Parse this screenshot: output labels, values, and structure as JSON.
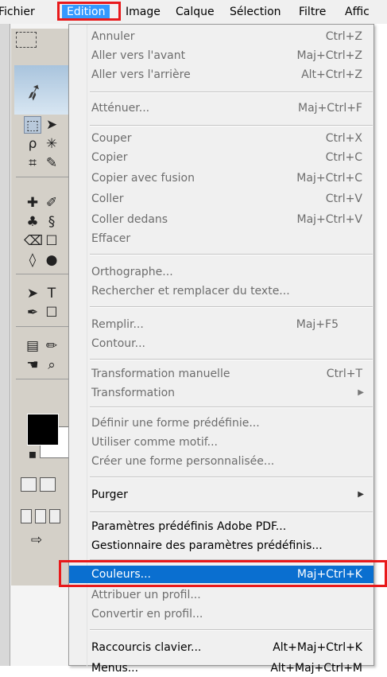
{
  "menubar": {
    "items": [
      {
        "label": "Fichier"
      },
      {
        "label": "Edition"
      },
      {
        "label": "Image"
      },
      {
        "label": "Calque"
      },
      {
        "label": "Sélection"
      },
      {
        "label": "Filtre"
      },
      {
        "label": "Affic"
      }
    ]
  },
  "dropdown": {
    "items": [
      {
        "label": "Annuler",
        "shortcut": "Ctrl+Z",
        "enabled": false
      },
      {
        "label": "Aller vers l'avant",
        "shortcut": "Maj+Ctrl+Z",
        "enabled": false
      },
      {
        "label": "Aller vers l'arrière",
        "shortcut": "Alt+Ctrl+Z",
        "enabled": false
      },
      {
        "label": "Atténuer...",
        "shortcut": "Maj+Ctrl+F",
        "enabled": false
      },
      {
        "label": "Couper",
        "shortcut": "Ctrl+X",
        "enabled": false
      },
      {
        "label": "Copier",
        "shortcut": "Ctrl+C",
        "enabled": false
      },
      {
        "label": "Copier avec fusion",
        "shortcut": "Maj+Ctrl+C",
        "enabled": false
      },
      {
        "label": "Coller",
        "shortcut": "Ctrl+V",
        "enabled": false
      },
      {
        "label": "Coller dedans",
        "shortcut": "Maj+Ctrl+V",
        "enabled": false
      },
      {
        "label": "Effacer",
        "shortcut": "",
        "enabled": false
      },
      {
        "label": "Orthographe...",
        "shortcut": "",
        "enabled": false
      },
      {
        "label": "Rechercher et remplacer du texte...",
        "shortcut": "",
        "enabled": false
      },
      {
        "label": "Remplir...",
        "shortcut": "Maj+F5",
        "enabled": false
      },
      {
        "label": "Contour...",
        "shortcut": "",
        "enabled": false
      },
      {
        "label": "Transformation manuelle",
        "shortcut": "Ctrl+T",
        "enabled": false
      },
      {
        "label": "Transformation",
        "shortcut": "",
        "enabled": false,
        "submenu": true
      },
      {
        "label": "Définir une forme prédéfinie...",
        "shortcut": "",
        "enabled": false
      },
      {
        "label": "Utiliser comme motif...",
        "shortcut": "",
        "enabled": false
      },
      {
        "label": "Créer une forme personnalisée...",
        "shortcut": "",
        "enabled": false
      },
      {
        "label": "Purger",
        "shortcut": "",
        "enabled": true,
        "submenu": true
      },
      {
        "label": "Paramètres prédéfinis Adobe PDF...",
        "shortcut": "",
        "enabled": true
      },
      {
        "label": "Gestionnaire des paramètres prédéfinis...",
        "shortcut": "",
        "enabled": true
      },
      {
        "label": "Couleurs...",
        "shortcut": "Maj+Ctrl+K",
        "enabled": true,
        "highlighted": true
      },
      {
        "label": "Attribuer un profil...",
        "shortcut": "",
        "enabled": false
      },
      {
        "label": "Convertir en profil...",
        "shortcut": "",
        "enabled": false
      },
      {
        "label": "Raccourcis clavier...",
        "shortcut": "Alt+Maj+Ctrl+K",
        "enabled": true
      },
      {
        "label": "Menus...",
        "shortcut": "Alt+Maj+Ctrl+M",
        "enabled": true
      }
    ]
  },
  "colors": {
    "highlight_bg": "#0a6fd0",
    "menu_open_bg": "#3399ff",
    "annotation_red": "#e8191b",
    "disabled_text": "#6d6d6d"
  },
  "icons": {
    "submenu_arrow": "▶"
  }
}
